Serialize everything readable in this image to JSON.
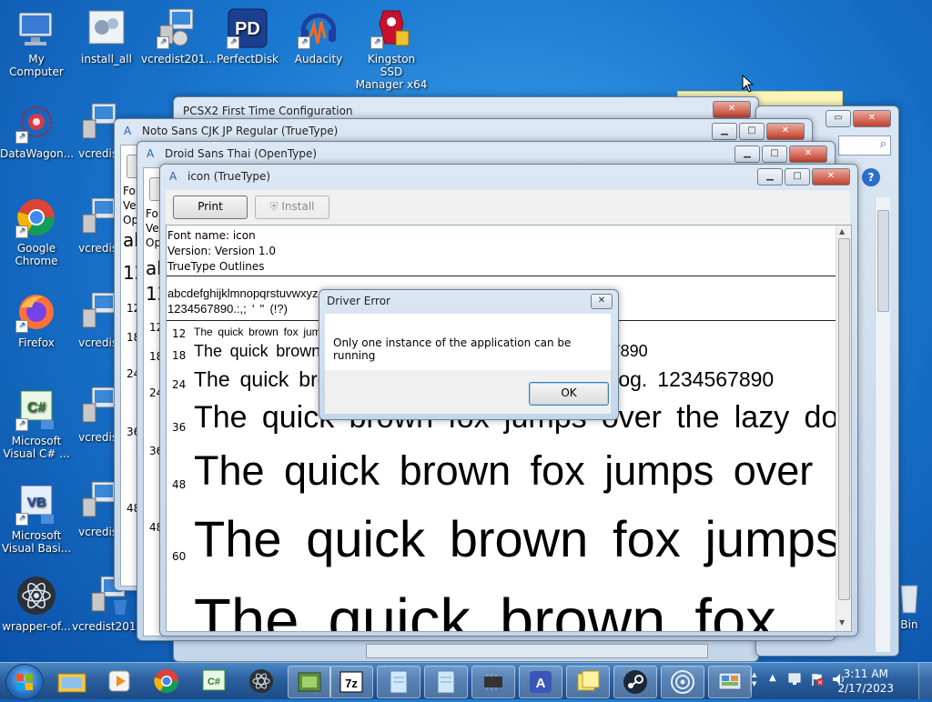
{
  "desktop_icons": [
    {
      "label": "My Computer",
      "icon": "computer-icon"
    },
    {
      "label": "install_all",
      "icon": "installer-icon"
    },
    {
      "label": "vcredist201...",
      "icon": "setup-icon"
    },
    {
      "label": "PerfectDisk",
      "icon": "perfectdisk-icon"
    },
    {
      "label": "Audacity",
      "icon": "audacity-icon"
    },
    {
      "label": "Kingston SSD Manager x64",
      "icon": "kingston-icon"
    },
    {
      "label": "DataWagon...",
      "icon": "datawagon-icon"
    },
    {
      "label": "vcredist",
      "icon": "setup-icon"
    },
    {
      "label": "Google Chrome",
      "icon": "chrome-icon"
    },
    {
      "label": "vcredist",
      "icon": "setup-icon"
    },
    {
      "label": "Firefox",
      "icon": "firefox-icon"
    },
    {
      "label": "vcredist",
      "icon": "setup-icon"
    },
    {
      "label": "Microsoft Visual C# ...",
      "icon": "visual-csharp-icon"
    },
    {
      "label": "vcredist",
      "icon": "setup-icon"
    },
    {
      "label": "Microsoft Visual Basi...",
      "icon": "visual-basic-icon"
    },
    {
      "label": "vcredist",
      "icon": "setup-icon"
    },
    {
      "label": "wrapper-of...",
      "icon": "atom-icon"
    },
    {
      "label": "vcredist201...",
      "icon": "setup-icon"
    },
    {
      "label": "Bin",
      "icon": "recycle-bin-icon"
    }
  ],
  "windows": {
    "pcsx2": {
      "title": "PCSX2 First Time Configuration"
    },
    "noto": {
      "title": "Noto Sans CJK JP Regular (TrueType)",
      "partial": [
        "Fon",
        "Ver",
        "Op",
        "ab",
        "12",
        "12",
        "18",
        "24",
        "36",
        "48"
      ]
    },
    "droid": {
      "title": "Droid Sans Thai (OpenType)",
      "partial": [
        "Fon",
        "Ver",
        "Op",
        "ab",
        "12",
        "12",
        "18",
        "24",
        "36",
        "48"
      ]
    },
    "icon_font": {
      "title": "icon (TrueType)",
      "print_label": "Print",
      "install_label": "Install",
      "font_name": "Font name: icon",
      "version": "Version: Version 1.0",
      "outline": "TrueType Outlines",
      "charset_line1": "abcdefghijklmnopqrstuvwxyz ABCDEFGHIJKLMNOPQRSTUVWXYZ",
      "charset_line2": "1234567890.:,; ' \" (!?)",
      "samples": [
        {
          "size": "12",
          "text": "The quick brown fox jumps over the lazy dog. 1234567890"
        },
        {
          "size": "18",
          "text": "The quick brown fox jumps over the lazy dog. 1234567890"
        },
        {
          "size": "24",
          "text": "The quick brown fox jumps over the lazy dog. 1234567890"
        },
        {
          "size": "36",
          "text": "The quick brown fox jumps over the lazy dog."
        },
        {
          "size": "48",
          "text": "The quick brown fox jumps over"
        },
        {
          "size": "60",
          "text": "The quick brown fox jumps"
        },
        {
          "size": "72",
          "text": "The quick brown fox"
        }
      ]
    }
  },
  "dialog": {
    "title": "Driver Error",
    "message": "Only one instance of the application can be running",
    "ok_label": "OK"
  },
  "taskbar": {
    "items": [
      "windows-explorer-icon",
      "media-player-icon",
      "chrome-icon",
      "visual-csharp-icon",
      "atom-icon",
      "gpu-icon",
      "7zip-icon",
      "notepad-icon",
      "notepad-icon",
      "chip-icon",
      "font-viewer-icon",
      "sticky-notes-icon",
      "steam-icon",
      "spiral-app-icon",
      "control-panel-icon"
    ],
    "time": "3:11 AM",
    "date": "2/17/2023"
  }
}
